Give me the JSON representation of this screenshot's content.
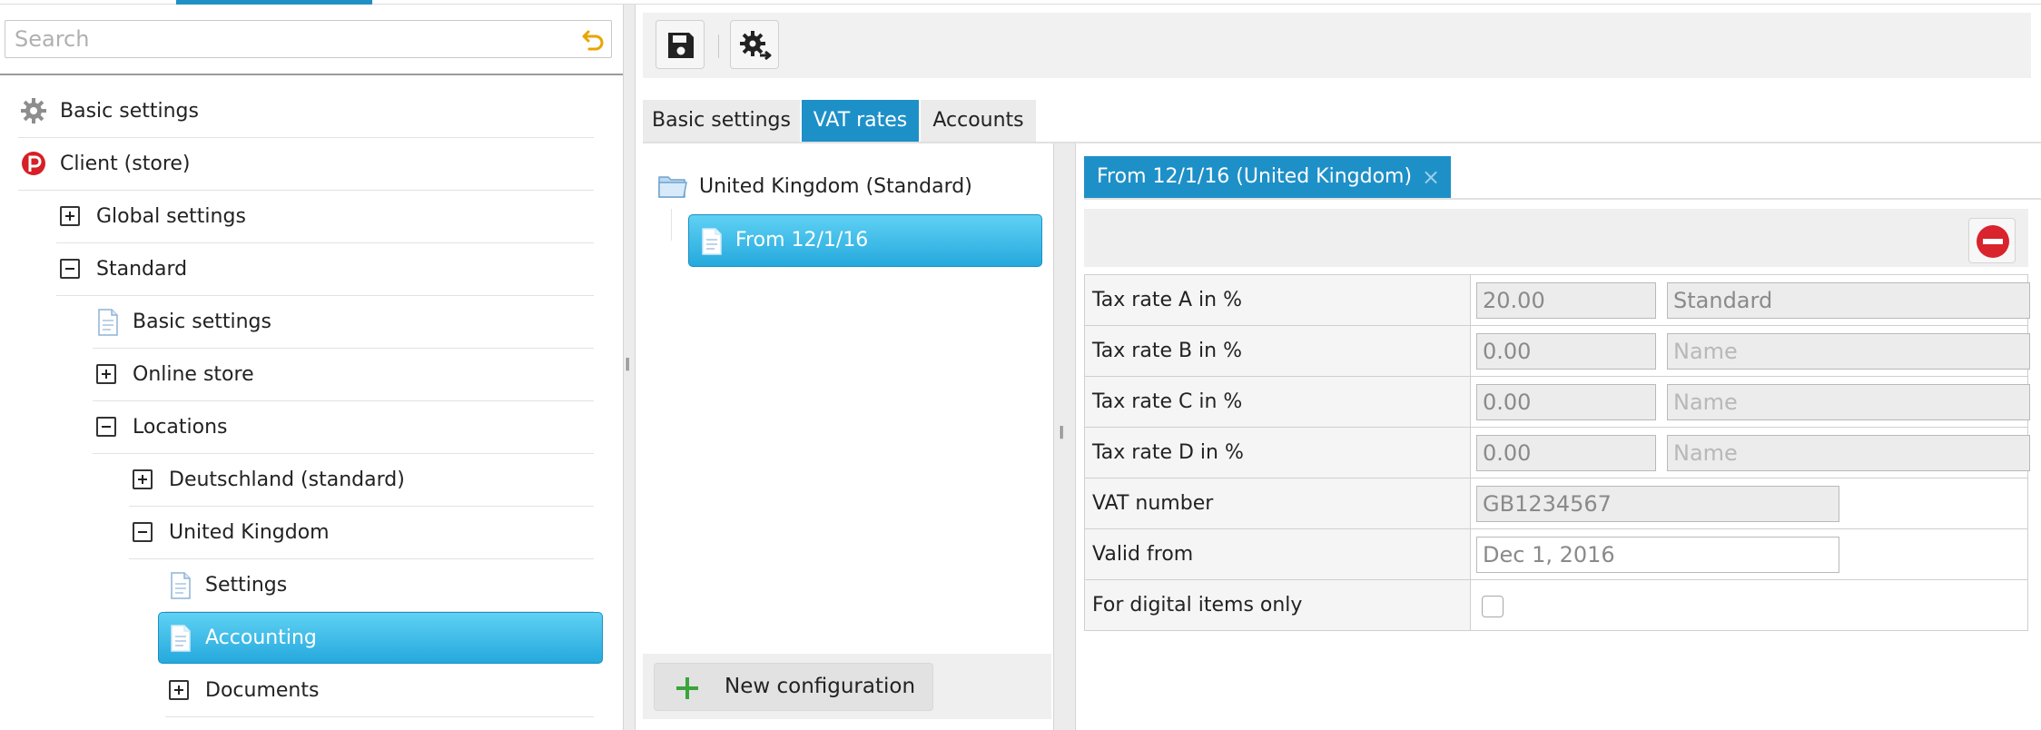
{
  "search": {
    "placeholder": "Search"
  },
  "tree": {
    "items": [
      {
        "label": "Basic settings"
      },
      {
        "label": "Client (store)"
      },
      {
        "label": "Global settings"
      },
      {
        "label": "Standard"
      },
      {
        "label": "Basic settings"
      },
      {
        "label": "Online store"
      },
      {
        "label": "Locations"
      },
      {
        "label": "Deutschland (standard)"
      },
      {
        "label": "United Kingdom"
      },
      {
        "label": "Settings"
      },
      {
        "label": "Accounting"
      },
      {
        "label": "Documents"
      }
    ]
  },
  "tabs": [
    {
      "label": "Basic settings"
    },
    {
      "label": "VAT rates"
    },
    {
      "label": "Accounts"
    }
  ],
  "config_tree": {
    "folder": "United Kingdom (Standard)",
    "item": "From 12/1/16",
    "new_button": "New configuration"
  },
  "detail": {
    "tab_title": "From 12/1/16 (United Kingdom)",
    "rows": [
      {
        "label": "Tax rate A in %",
        "value": "20.00",
        "name_value": "Standard",
        "name_placeholder": "Name"
      },
      {
        "label": "Tax rate B in %",
        "value": "0.00",
        "name_value": "",
        "name_placeholder": "Name"
      },
      {
        "label": "Tax rate C in %",
        "value": "0.00",
        "name_value": "",
        "name_placeholder": "Name"
      },
      {
        "label": "Tax rate D in %",
        "value": "0.00",
        "name_value": "",
        "name_placeholder": "Name"
      }
    ],
    "vat_number_label": "VAT number",
    "vat_number_value": "GB1234567",
    "valid_from_label": "Valid from",
    "valid_from_value": "Dec 1, 2016",
    "digital_only_label": "For digital items only",
    "digital_only_checked": false
  },
  "colors": {
    "accent": "#1e90c8",
    "selection": "#3dbde9",
    "remove": "#d9232d",
    "add": "#3aa53a",
    "undo": "#e8a400"
  }
}
